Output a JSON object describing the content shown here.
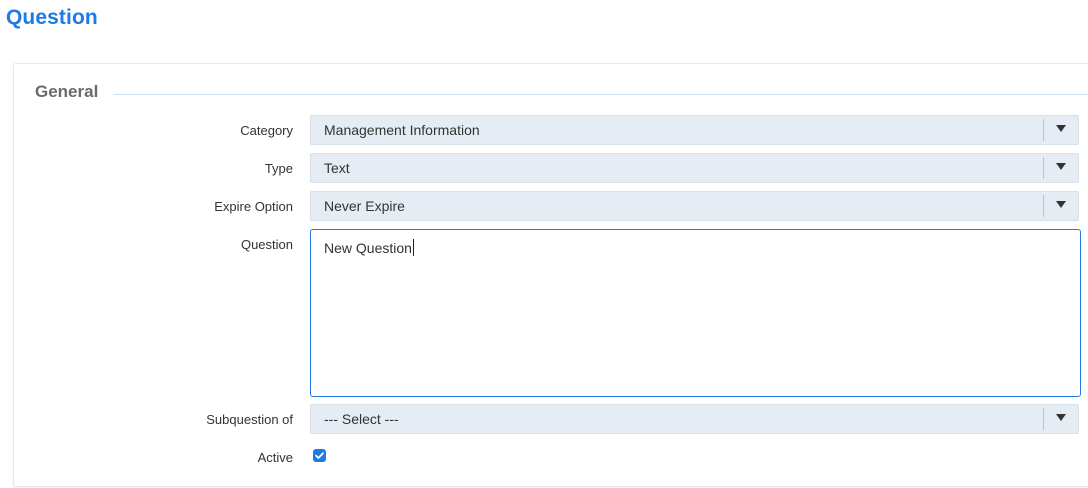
{
  "page": {
    "title": "Question"
  },
  "form": {
    "section_title": "General",
    "fields": {
      "category": {
        "label": "Category",
        "value": "Management Information"
      },
      "type": {
        "label": "Type",
        "value": "Text"
      },
      "expire_option": {
        "label": "Expire Option",
        "value": "Never Expire"
      },
      "question": {
        "label": "Question",
        "value": "New Question"
      },
      "subquestion_of": {
        "label": "Subquestion of",
        "value": "--- Select ---"
      },
      "active": {
        "label": "Active",
        "checked": true
      }
    }
  },
  "colors": {
    "accent": "#1f7ae8",
    "select_background": "#e6ecf4",
    "section_rule": "#cfe0f5"
  },
  "icons": {
    "dropdown": "caret-down-icon",
    "checkbox": "checkmark-icon"
  }
}
